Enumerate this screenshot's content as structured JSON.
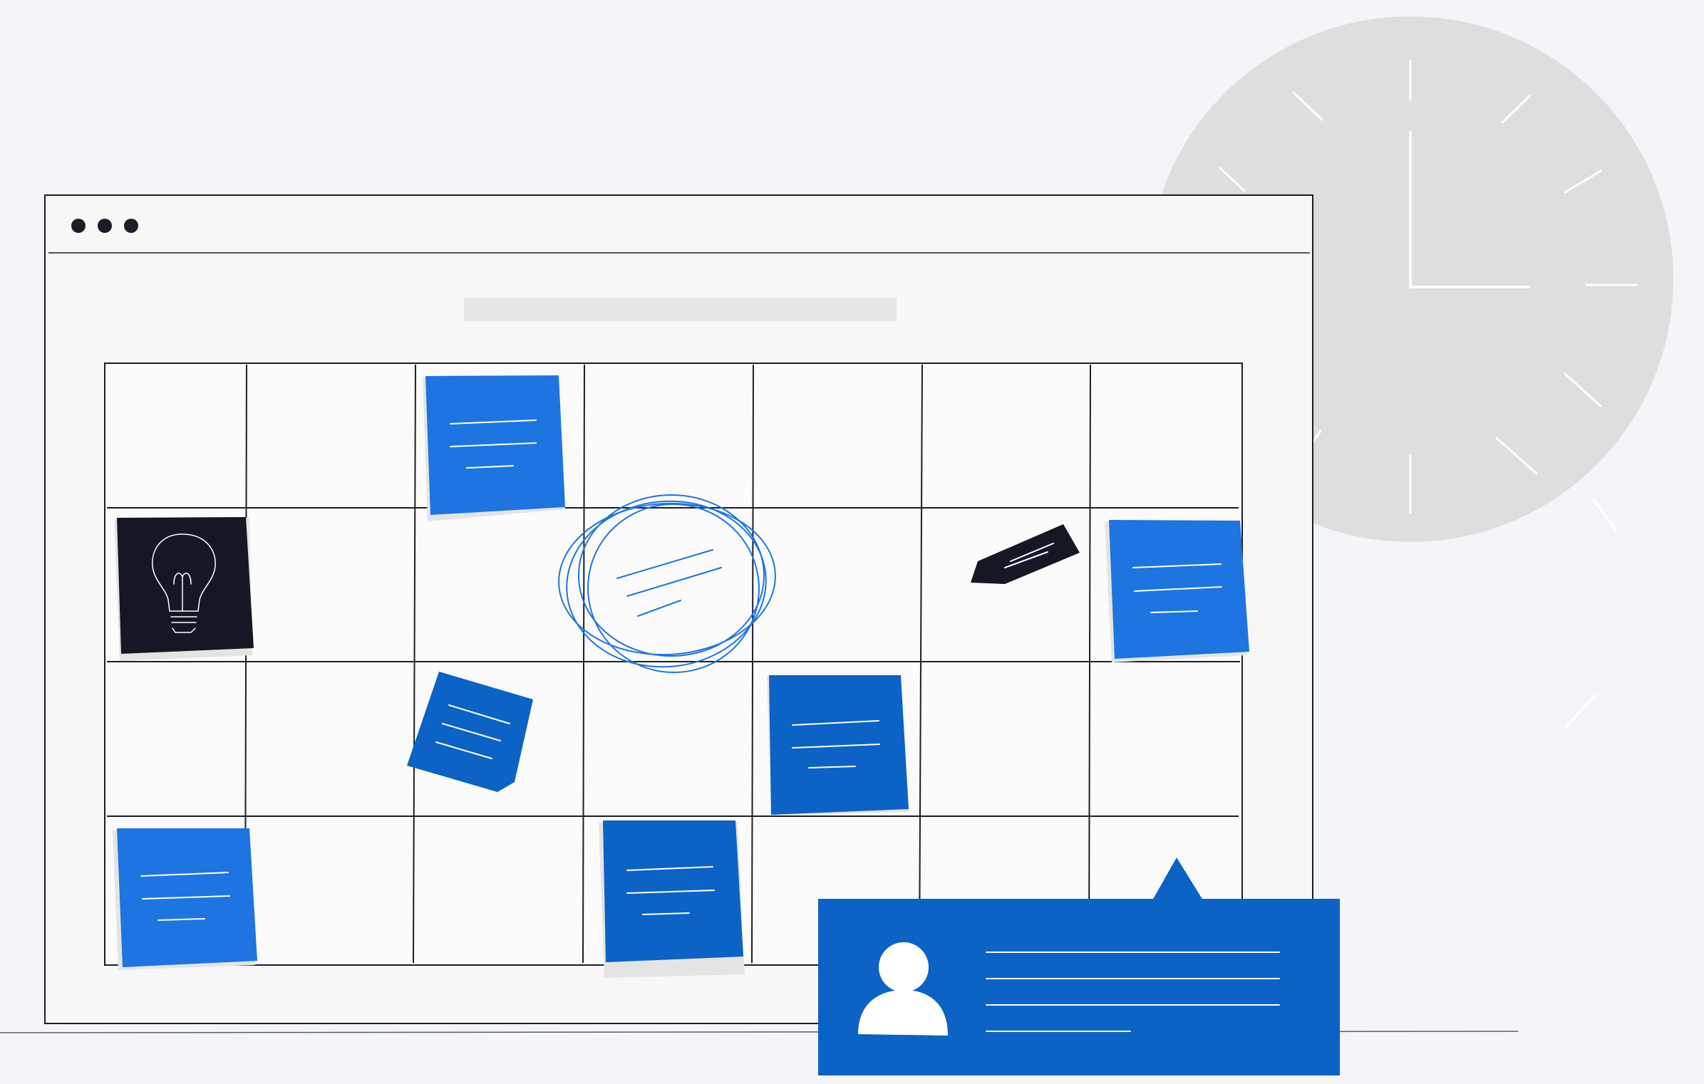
{
  "illustration": {
    "subject": "planning-board",
    "window_controls": [
      "close",
      "minimize",
      "maximize"
    ],
    "colors": {
      "background": "#f3f5f8",
      "window": "#f7f7f7",
      "outline": "#1b1e27",
      "clock_face": "#dedede",
      "clock_marks": "#ffffff",
      "note_blue": "#1e74e0",
      "note_blue_dark": "#0c62c5",
      "note_dark": "#151824",
      "title_bar_placeholder": "#e6e6e6",
      "shadow": "#e4e4e4"
    },
    "icons": [
      "clock-icon",
      "lightbulb-icon",
      "marker-icon",
      "user-avatar-icon"
    ]
  }
}
